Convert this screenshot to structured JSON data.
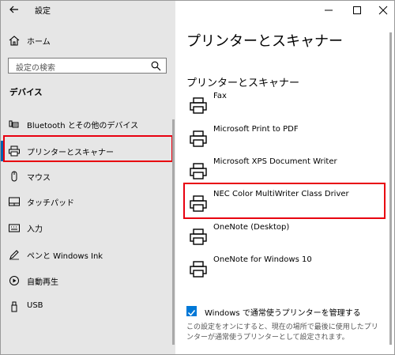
{
  "window": {
    "title": "設定"
  },
  "icons": {
    "back": "back-arrow-icon",
    "home": "home-icon",
    "search": "search-icon",
    "minimize": "minimize-icon",
    "maximize": "maximize-icon",
    "close": "close-icon",
    "printer": "printer-icon"
  },
  "sidebar": {
    "home_label": "ホーム",
    "search_placeholder": "設定の検索",
    "section_title": "デバイス",
    "items": [
      {
        "label": "Bluetooth とその他のデバイス",
        "icon": "bluetooth-devices-icon"
      },
      {
        "label": "プリンターとスキャナー",
        "icon": "printer-icon"
      },
      {
        "label": "マウス",
        "icon": "mouse-icon"
      },
      {
        "label": "タッチパッド",
        "icon": "touchpad-icon"
      },
      {
        "label": "入力",
        "icon": "keyboard-icon"
      },
      {
        "label": "ペンと Windows Ink",
        "icon": "pen-icon"
      },
      {
        "label": "自動再生",
        "icon": "autoplay-icon"
      },
      {
        "label": "USB",
        "icon": "usb-icon"
      }
    ]
  },
  "main": {
    "title": "プリンターとスキャナー",
    "subtitle": "プリンターとスキャナー",
    "printers": [
      "Fax",
      "Microsoft Print to PDF",
      "Microsoft XPS Document Writer",
      "NEC Color MultiWriter Class Driver",
      "OneNote (Desktop)",
      "OneNote for Windows 10"
    ],
    "checkbox_label": "Windows で通常使うプリンターを管理する",
    "checkbox_checked": true,
    "description": "この設定をオンにすると、現在の場所で最後に使用したプリンターが通常使うプリンターとして設定されます。"
  },
  "colors": {
    "accent": "#0078d7",
    "highlight": "#e8000f",
    "sidebar_bg": "#e6e6e6"
  }
}
